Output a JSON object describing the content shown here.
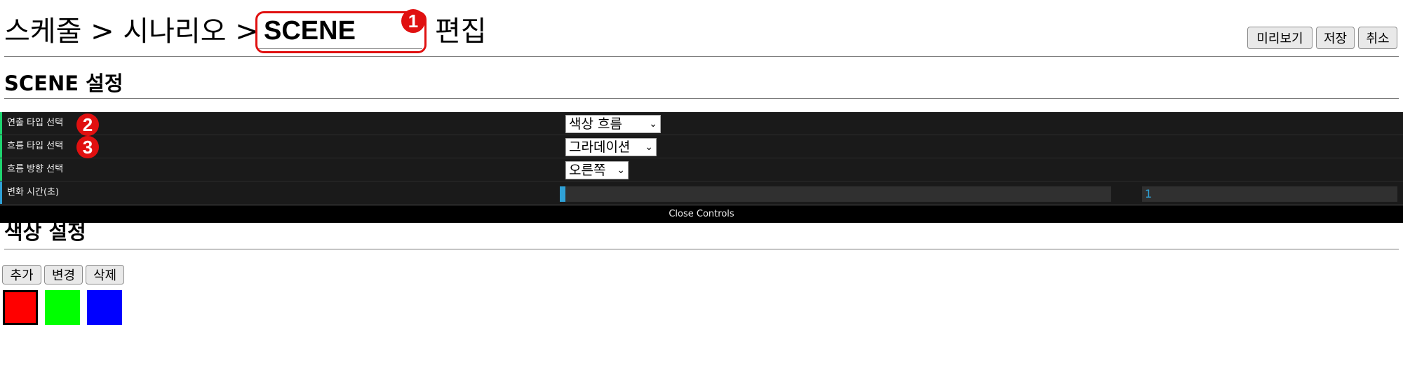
{
  "header": {
    "breadcrumb": "스케줄 > 시나리오 >",
    "scene_value": "SCENE",
    "edit_label": "편집",
    "buttons": {
      "preview": "미리보기",
      "save": "저장",
      "cancel": "취소"
    }
  },
  "badges": {
    "b1": "1",
    "b2": "2",
    "b3": "3"
  },
  "scene_section": {
    "title": "SCENE 설정"
  },
  "controls": {
    "rows": [
      {
        "label": "연출 타입 선택",
        "value": "색상 흐름",
        "stripe_color": "#1ed36f"
      },
      {
        "label": "흐름 타입 선택",
        "value": "그라데이션",
        "stripe_color": "#1ed36f"
      },
      {
        "label": "흐름 방향 선택",
        "value": "오른쪽",
        "stripe_color": "#1ed36f"
      },
      {
        "label": "변화 시간(초)",
        "value": "1",
        "stripe_color": "#2fa1d6"
      }
    ],
    "slider_fraction": 0.01,
    "close_label": "Close Controls"
  },
  "color_section": {
    "title": "색상 설정",
    "buttons": {
      "add": "추가",
      "change": "변경",
      "delete": "삭제"
    },
    "swatches": [
      "#ff0000",
      "#00ff00",
      "#0000ff"
    ],
    "selected_index": 0
  },
  "colors": {
    "accent_red": "#e01010",
    "slider_blue": "#2fa1d6",
    "panel_bg": "#1a1a1a"
  }
}
